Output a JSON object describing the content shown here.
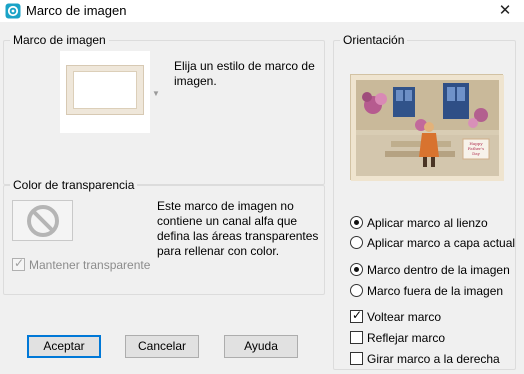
{
  "window": {
    "title": "Marco de imagen",
    "icon": "app-swirl-icon",
    "close_symbol": "✕"
  },
  "picture_frame": {
    "label": "Marco de imagen",
    "description_line1": "Elija un estilo de marco de",
    "description_line2": "imagen."
  },
  "transparency": {
    "label": "Color de transparencia",
    "message_line1": "Este marco de imagen no",
    "message_line2": "contiene un canal alfa que",
    "message_line3": "defina las áreas transparentes",
    "message_line4": "para rellenar con color.",
    "keep_transparent_label": "Mantener transparente",
    "keep_transparent_checked": true,
    "keep_transparent_enabled": false
  },
  "orientation": {
    "label": "Orientación",
    "preview_card_text_line1": "Happy",
    "preview_card_text_line2": "Father's",
    "preview_card_text_line3": "Day",
    "apply_group_1": [
      {
        "label": "Aplicar marco al lienzo",
        "selected": true
      },
      {
        "label": "Aplicar marco a capa actual",
        "selected": false
      }
    ],
    "apply_group_2": [
      {
        "label": "Marco dentro de la imagen",
        "selected": true
      },
      {
        "label": "Marco fuera de la imagen",
        "selected": false
      }
    ],
    "checkboxes": [
      {
        "label": "Voltear marco",
        "checked": true
      },
      {
        "label": "Reflejar marco",
        "checked": false
      },
      {
        "label": "Girar marco a la derecha",
        "checked": false
      }
    ]
  },
  "buttons": {
    "ok": "Aceptar",
    "cancel": "Cancelar",
    "help": "Ayuda"
  },
  "colors": {
    "accent": "#0078d7",
    "dialog_bg": "#f0f0f0"
  }
}
